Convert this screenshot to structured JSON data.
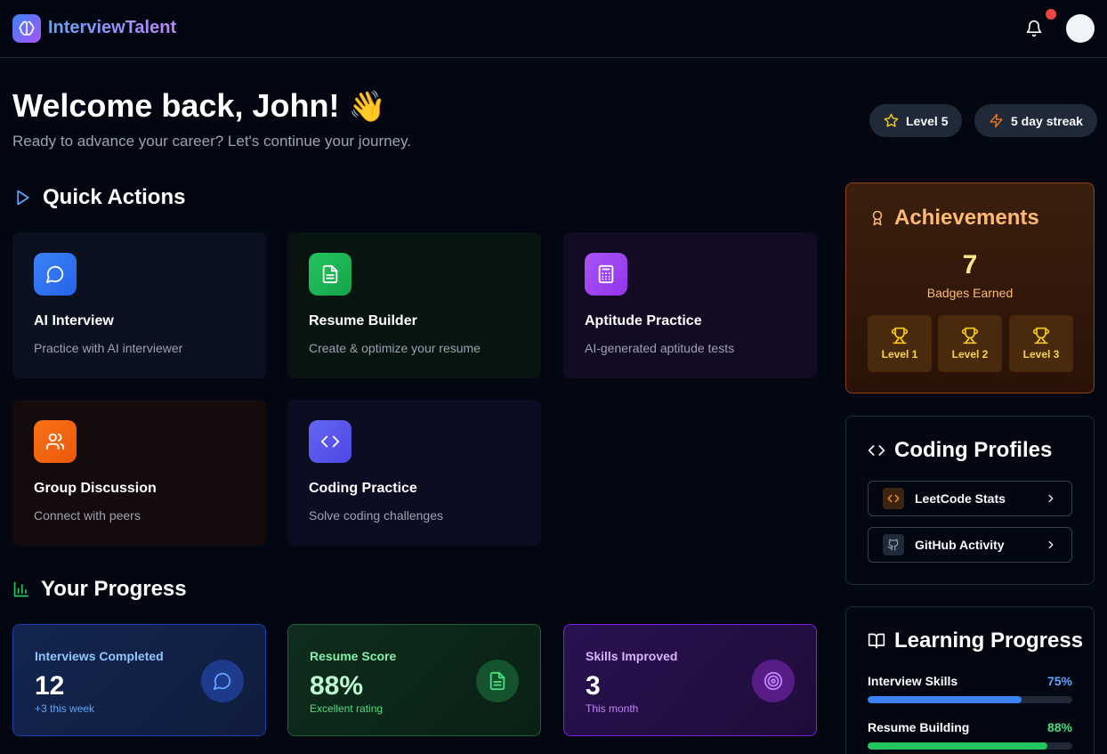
{
  "header": {
    "brand": "InterviewTalent"
  },
  "welcome": {
    "title": "Welcome back, John!",
    "emoji": "👋",
    "subtitle": "Ready to advance your career? Let's continue your journey."
  },
  "pills": {
    "level": "Level 5",
    "streak": "5 day streak"
  },
  "quick_actions": {
    "title": "Quick Actions",
    "items": [
      {
        "title": "AI Interview",
        "desc": "Practice with AI interviewer",
        "icon": "chat-icon",
        "color": "#3b82f6"
      },
      {
        "title": "Resume Builder",
        "desc": "Create & optimize your resume",
        "icon": "document-icon",
        "color": "#22c55e"
      },
      {
        "title": "Aptitude Practice",
        "desc": "AI-generated aptitude tests",
        "icon": "calculator-icon",
        "color": "#a855f7"
      },
      {
        "title": "Group Discussion",
        "desc": "Connect with peers",
        "icon": "users-icon",
        "color": "#f97316"
      },
      {
        "title": "Coding Practice",
        "desc": "Solve coding challenges",
        "icon": "code-icon",
        "color": "#6366f1"
      }
    ]
  },
  "progress": {
    "title": "Your Progress",
    "cards": [
      {
        "label": "Interviews Completed",
        "value": "12",
        "sub": "+3 this week",
        "icon": "chat-icon"
      },
      {
        "label": "Resume Score",
        "value": "88%",
        "sub": "Excellent rating",
        "icon": "document-icon"
      },
      {
        "label": "Skills Improved",
        "value": "3",
        "sub": "This month",
        "icon": "target-icon"
      }
    ]
  },
  "achievements": {
    "title": "Achievements",
    "count": "7",
    "label": "Badges Earned",
    "badges": [
      "Level 1",
      "Level 2",
      "Level 3"
    ]
  },
  "coding_profiles": {
    "title": "Coding Profiles",
    "items": [
      {
        "label": "LeetCode Stats",
        "icon": "code-icon"
      },
      {
        "label": "GitHub Activity",
        "icon": "github-icon"
      }
    ]
  },
  "learning": {
    "title": "Learning Progress",
    "items": [
      {
        "label": "Interview Skills",
        "percent": "75%",
        "value": 0.75,
        "color": "#3b82f6"
      },
      {
        "label": "Resume Building",
        "percent": "88%",
        "value": 0.88,
        "color": "#22c55e"
      }
    ]
  }
}
